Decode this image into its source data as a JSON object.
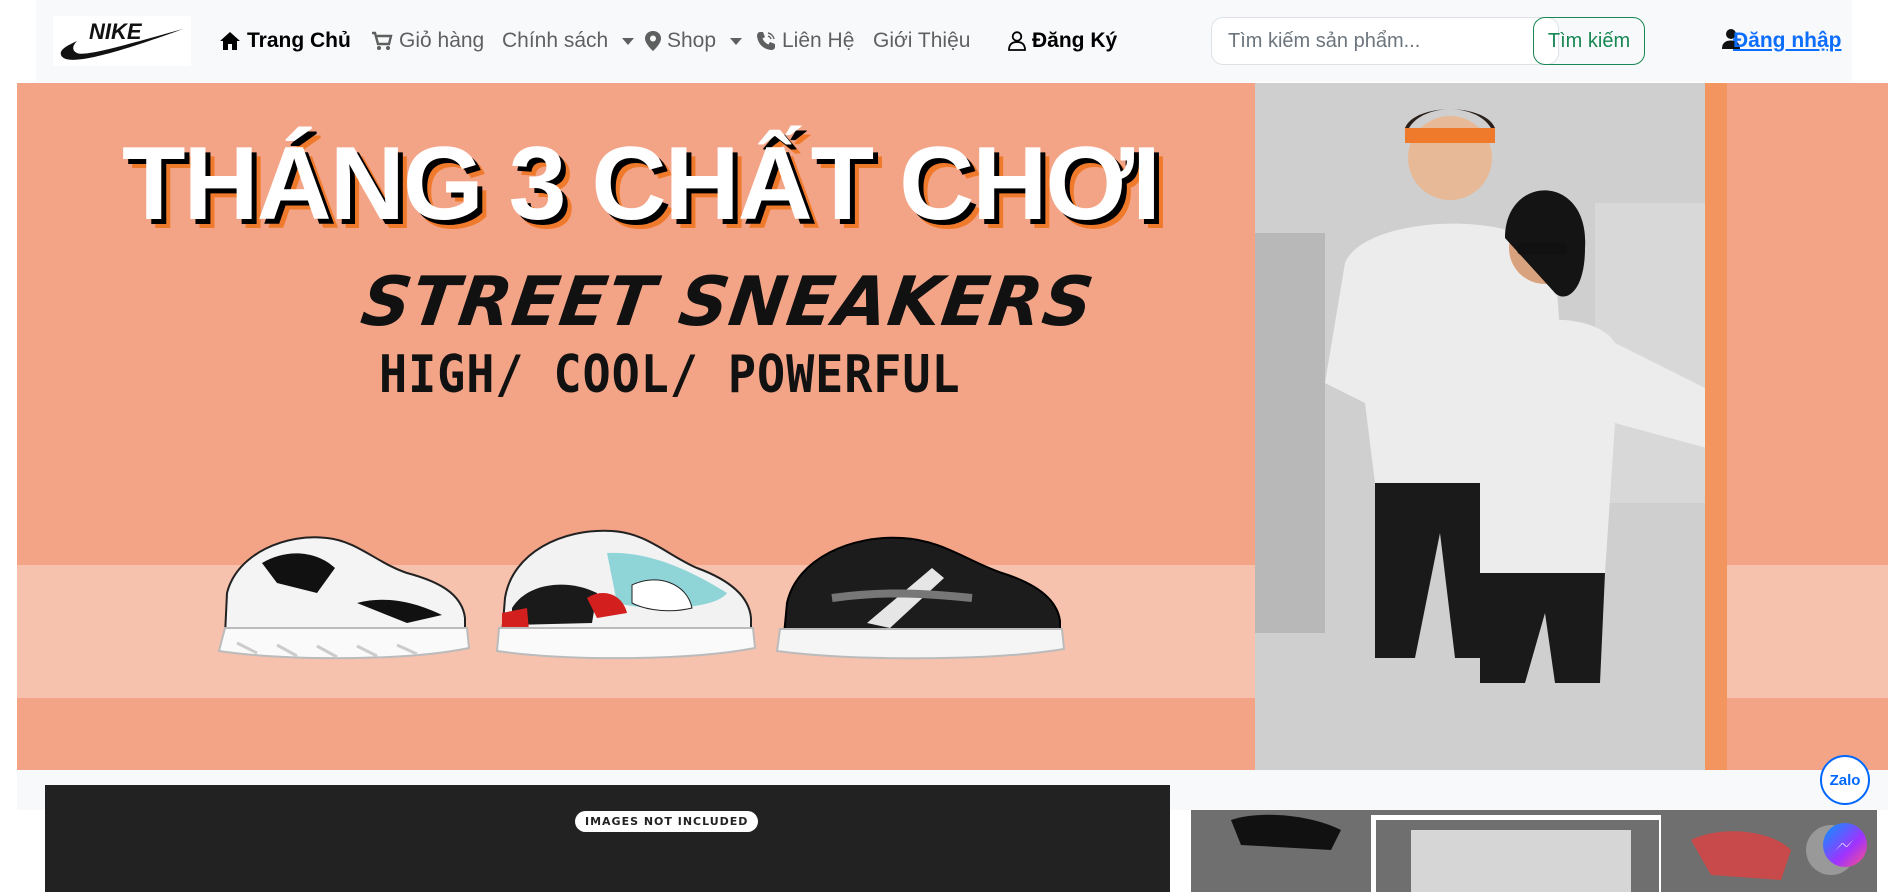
{
  "brand": {
    "logo_text": "NIKE"
  },
  "nav": {
    "home_label": "Trang Chủ",
    "cart_label": "Giỏ hàng",
    "policy_label": "Chính sách",
    "shop_label": "Shop",
    "contact_label": "Liên Hệ",
    "about_label": "Giới Thiệu",
    "register_label": "Đăng Ký"
  },
  "search": {
    "placeholder": "Tìm kiếm sản phẩm...",
    "value": "",
    "button_label": "Tìm kiếm"
  },
  "account": {
    "login_label": "Đăng nhập"
  },
  "hero": {
    "title": "THÁNG 3 CHẤT CHƠI",
    "subtitle": "STREET SNEAKERS",
    "tagline": "HIGH/ COOL/ POWERFUL"
  },
  "video": {
    "badge": "IMAGES NOT INCLUDED"
  },
  "floating": {
    "zalo_label": "Zalo"
  },
  "colors": {
    "hero_bg": "#f3a487",
    "accent_green": "#198754",
    "link_blue": "#0d6efd"
  }
}
